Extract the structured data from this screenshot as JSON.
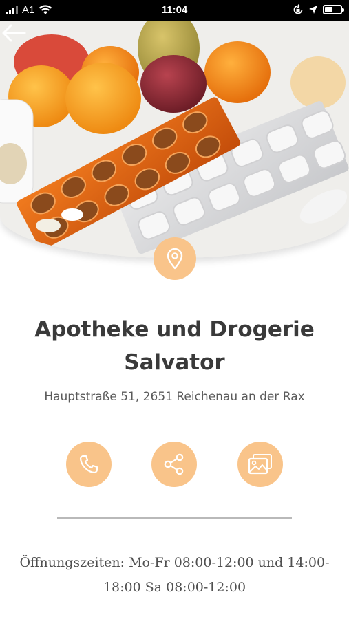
{
  "status_bar": {
    "carrier": "A1",
    "time": "11:04",
    "icons": [
      "signal-icon",
      "wifi-icon",
      "rotation-lock-icon",
      "location-arrow-icon",
      "battery-icon"
    ]
  },
  "hero": {
    "image": "pills-and-fruit-photo",
    "back_icon": "arrow-left-icon"
  },
  "location_icon": "map-pin-icon",
  "store": {
    "name": "Apotheke und Drogerie Salvator",
    "address": "Hauptstraße 51, 2651 Reichenau an der Rax"
  },
  "actions": [
    {
      "name": "call",
      "icon": "phone-icon"
    },
    {
      "name": "share",
      "icon": "share-icon"
    },
    {
      "name": "gallery",
      "icon": "images-icon"
    }
  ],
  "opening_hours": "Öffnungszeiten: Mo-Fr 08:00-12:00 und 14:00-18:00 Sa 08:00-12:00",
  "colors": {
    "accent": "#f9c48a",
    "title": "#3a3a3a",
    "text": "#5a5a5a",
    "divider": "#b9b9b9"
  }
}
